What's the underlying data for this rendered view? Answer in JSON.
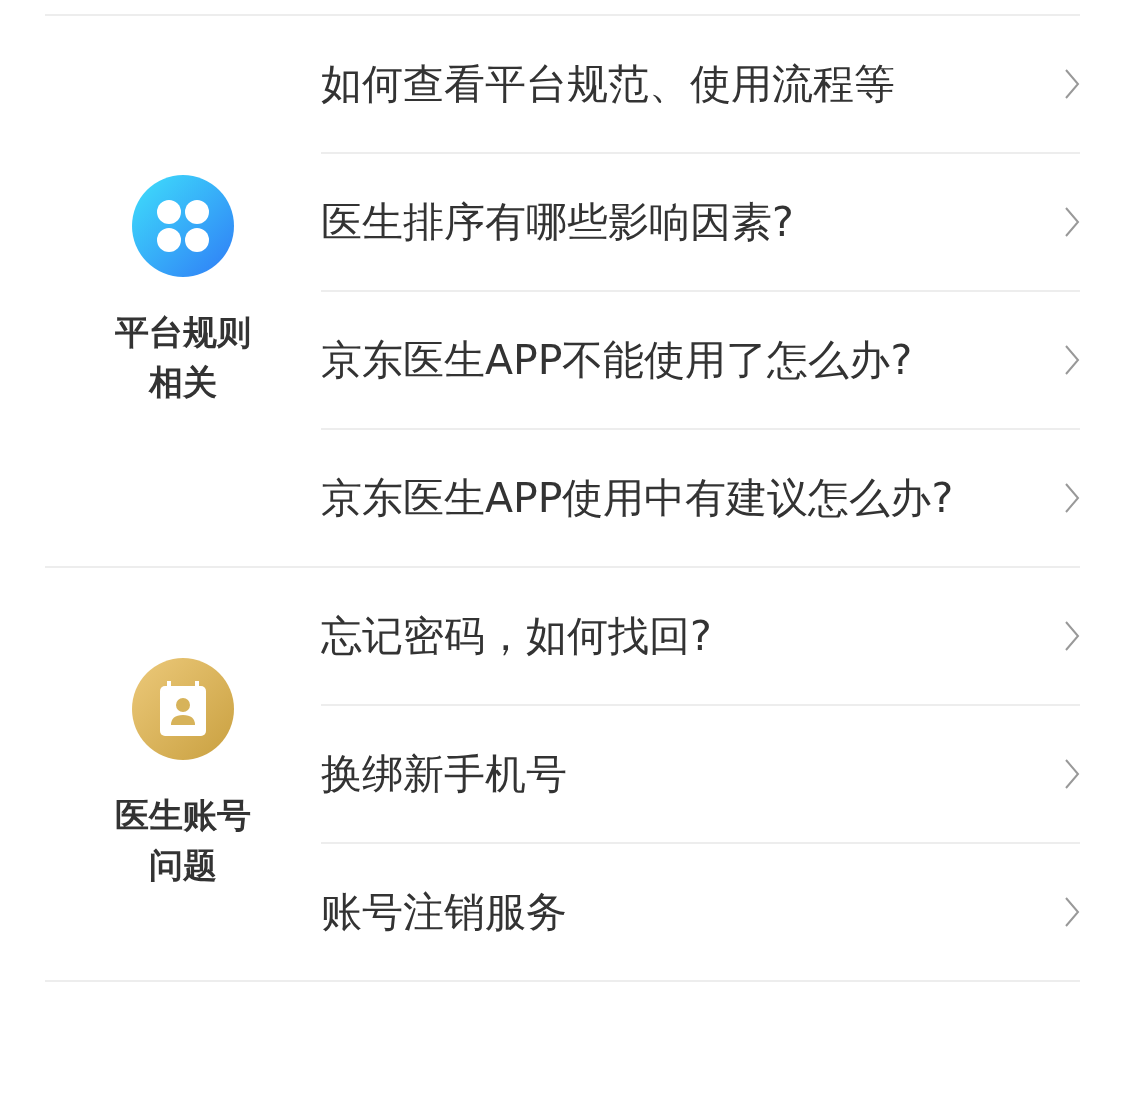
{
  "sections": [
    {
      "kind": "rules",
      "title": "平台规则相关",
      "questions": [
        "如何查看平台规范、使用流程等",
        "医生排序有哪些影响因素?",
        "京东医生APP不能使用了怎么办?",
        "京东医生APP使用中有建议怎么办?"
      ]
    },
    {
      "kind": "account",
      "title": "医生账号问题",
      "questions": [
        "忘记密码，如何找回?",
        "换绑新手机号",
        "账号注销服务"
      ]
    }
  ]
}
